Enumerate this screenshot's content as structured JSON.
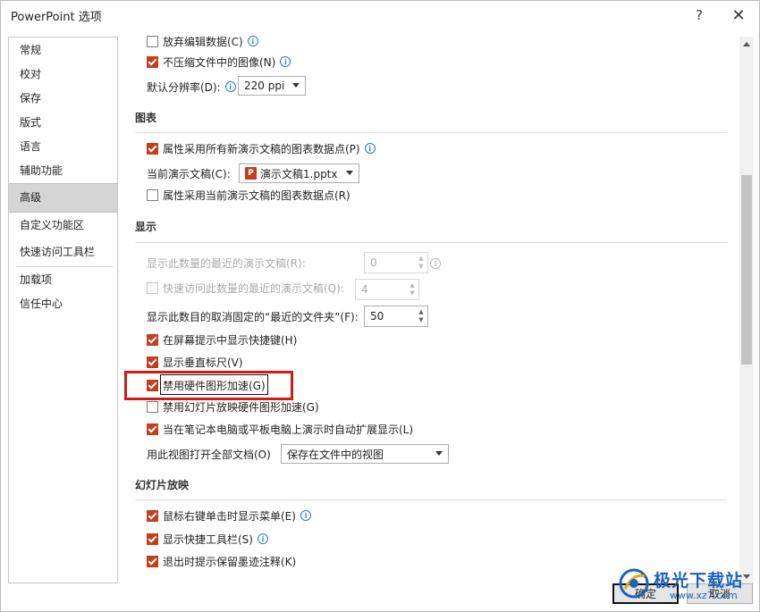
{
  "window": {
    "title": "PowerPoint 选项",
    "help": "?",
    "close": "✕"
  },
  "sidebar": {
    "items": [
      {
        "label": "常规"
      },
      {
        "label": "校对"
      },
      {
        "label": "保存"
      },
      {
        "label": "版式"
      },
      {
        "label": "语言"
      },
      {
        "label": "辅助功能"
      },
      {
        "label": "高级",
        "active": true
      },
      {
        "label": "自定义功能区"
      },
      {
        "label": "快速访问工具栏"
      },
      {
        "label": "加载项"
      },
      {
        "label": "信任中心"
      }
    ]
  },
  "image_section": {
    "discard_editing": {
      "label": "放弃编辑数据(C)",
      "checked": false
    },
    "no_compress": {
      "label": "不压缩文件中的图像(N)",
      "checked": true
    },
    "resolution_label": "默认分辨率(D):",
    "resolution_value": "220 ppi"
  },
  "chart_section": {
    "heading": "图表",
    "props_all_new": {
      "label": "属性采用所有新演示文稿的图表数据点(P)",
      "checked": true
    },
    "current_pres_label": "当前演示文稿(C):",
    "current_pres_value": "演示文稿1.pptx",
    "props_current": {
      "label": "属性采用当前演示文稿的图表数据点(R)",
      "checked": false
    }
  },
  "display_section": {
    "heading": "显示",
    "recent_count": {
      "label": "显示此数量的最近的演示文稿(R):",
      "value": "0",
      "disabled": true
    },
    "quick_access_recent": {
      "label": "快速访问此数量的最近的演示文稿(Q):",
      "value": "4",
      "disabled": true,
      "checked": false
    },
    "unpinned_folders": {
      "label": "显示此数目的取消固定的“最近的文件夹”(F):",
      "value": "50"
    },
    "shortcut_keys": {
      "label": "在屏幕提示中显示快捷键(H)",
      "checked": true
    },
    "vertical_ruler": {
      "label": "显示垂直标尺(V)",
      "checked": true
    },
    "disable_hw_accel": {
      "label": "禁用硬件图形加速(G)",
      "checked": true
    },
    "disable_slideshow_hw": {
      "label": "禁用幻灯片放映硬件图形加速(G)",
      "checked": false
    },
    "auto_extend": {
      "label": "当在笔记本电脑或平板电脑上演示时自动扩展显示(L)",
      "checked": true
    },
    "open_view_label": "用此视图打开全部文档(O)",
    "open_view_value": "保存在文件中的视图"
  },
  "slideshow_section": {
    "heading": "幻灯片放映",
    "right_click_menu": {
      "label": "鼠标右键单击时显示菜单(E)",
      "checked": true
    },
    "popup_toolbar": {
      "label": "显示快捷工具栏(S)",
      "checked": true
    },
    "keep_ink": {
      "label": "退出时提示保留墨迹注释(K)",
      "checked": true
    }
  },
  "footer": {
    "ok": "确定",
    "cancel": "取消"
  },
  "watermark": {
    "text": "极光下载站",
    "url": "www.xz7.com"
  },
  "colors": {
    "accent": "#c43e1c",
    "highlight": "#d11919",
    "watermark": "#1b62b8"
  }
}
